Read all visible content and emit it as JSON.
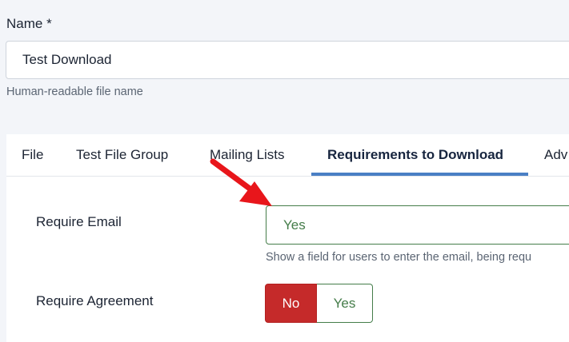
{
  "name_field": {
    "label": "Name *",
    "value": "Test Download",
    "help": "Human-readable file name"
  },
  "tabs": [
    {
      "label": "File",
      "active": false
    },
    {
      "label": "Test File Group",
      "active": false
    },
    {
      "label": "Mailing Lists",
      "active": false
    },
    {
      "label": "Requirements to Download",
      "active": true
    },
    {
      "label": "Adv",
      "active": false
    }
  ],
  "require_email": {
    "label": "Require Email",
    "value": "Yes",
    "help": "Show a field for users to enter the email, being requ"
  },
  "require_agreement": {
    "label": "Require Agreement",
    "options": [
      "No",
      "Yes"
    ],
    "selected": "No"
  },
  "colors": {
    "accent": "#4a7fc4",
    "success": "#457d4a",
    "danger": "#c52a2a",
    "annotation_arrow": "#e8161b"
  },
  "icons": {
    "annotation": "red-arrow-icon"
  }
}
